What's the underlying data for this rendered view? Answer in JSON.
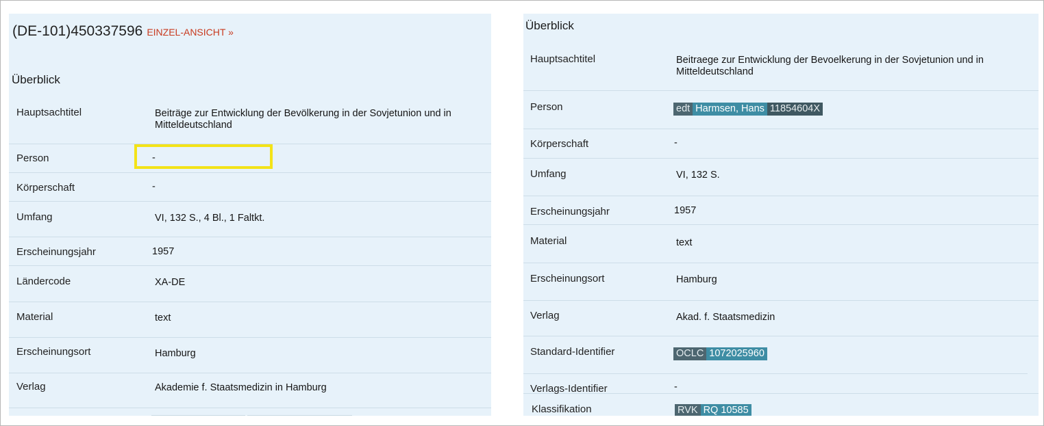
{
  "left": {
    "record_id": "(DE-101)450337596",
    "detail_link": "EINZEL-ANSICHT »",
    "section_title": "Überblick",
    "fields": {
      "title": {
        "label": "Hauptsachtitel",
        "value": "Beiträge zur Entwicklung der Bevölkerung in der Sovjetunion und in Mitteldeutschland"
      },
      "person": {
        "label": "Person",
        "value": "-"
      },
      "corporate": {
        "label": "Körperschaft",
        "value": "-"
      },
      "extent": {
        "label": "Umfang",
        "value": "VI, 132 S., 4 Bl., 1 Faltkt."
      },
      "year": {
        "label": "Erscheinungsjahr",
        "value": "1957"
      },
      "country": {
        "label": "Ländercode",
        "value": "XA-DE"
      },
      "material": {
        "label": "Material",
        "value": "text"
      },
      "place": {
        "label": "Erscheinungsort",
        "value": "Hamburg"
      },
      "publisher": {
        "label": "Verlag",
        "value": "Akademie f. Staatsmedizin in Hamburg"
      }
    }
  },
  "right": {
    "section_title": "Überblick",
    "fields": {
      "title": {
        "label": "Hauptsachtitel",
        "value": "Beitraege zur Entwicklung der Bevoelkerung in der Sovjetunion und in Mitteldeutschland"
      },
      "person": {
        "label": "Person",
        "role": "edt",
        "name": "Harmsen, Hans",
        "id": "11854604X"
      },
      "corporate": {
        "label": "Körperschaft",
        "value": "-"
      },
      "extent": {
        "label": "Umfang",
        "value": "VI, 132 S."
      },
      "year": {
        "label": "Erscheinungsjahr",
        "value": "1957"
      },
      "material": {
        "label": "Material",
        "value": "text"
      },
      "place": {
        "label": "Erscheinungsort",
        "value": "Hamburg"
      },
      "publisher": {
        "label": "Verlag",
        "value": "Akad. f. Staatsmedizin"
      },
      "standard_id": {
        "label": "Standard-Identifier",
        "type": "OCLC",
        "value": "1072025960"
      },
      "publisher_id": {
        "label": "Verlags-Identifier",
        "value": "-"
      },
      "classification": {
        "label": "Klassifikation",
        "type": "RVK",
        "value": "RQ 10585"
      }
    }
  },
  "colors": {
    "panel_bg": "#e7f2fa",
    "link_red": "#c8391e",
    "highlight_yellow": "#f3e318",
    "chip_teal": "#3e8da4",
    "chip_dark": "#4d6670"
  }
}
